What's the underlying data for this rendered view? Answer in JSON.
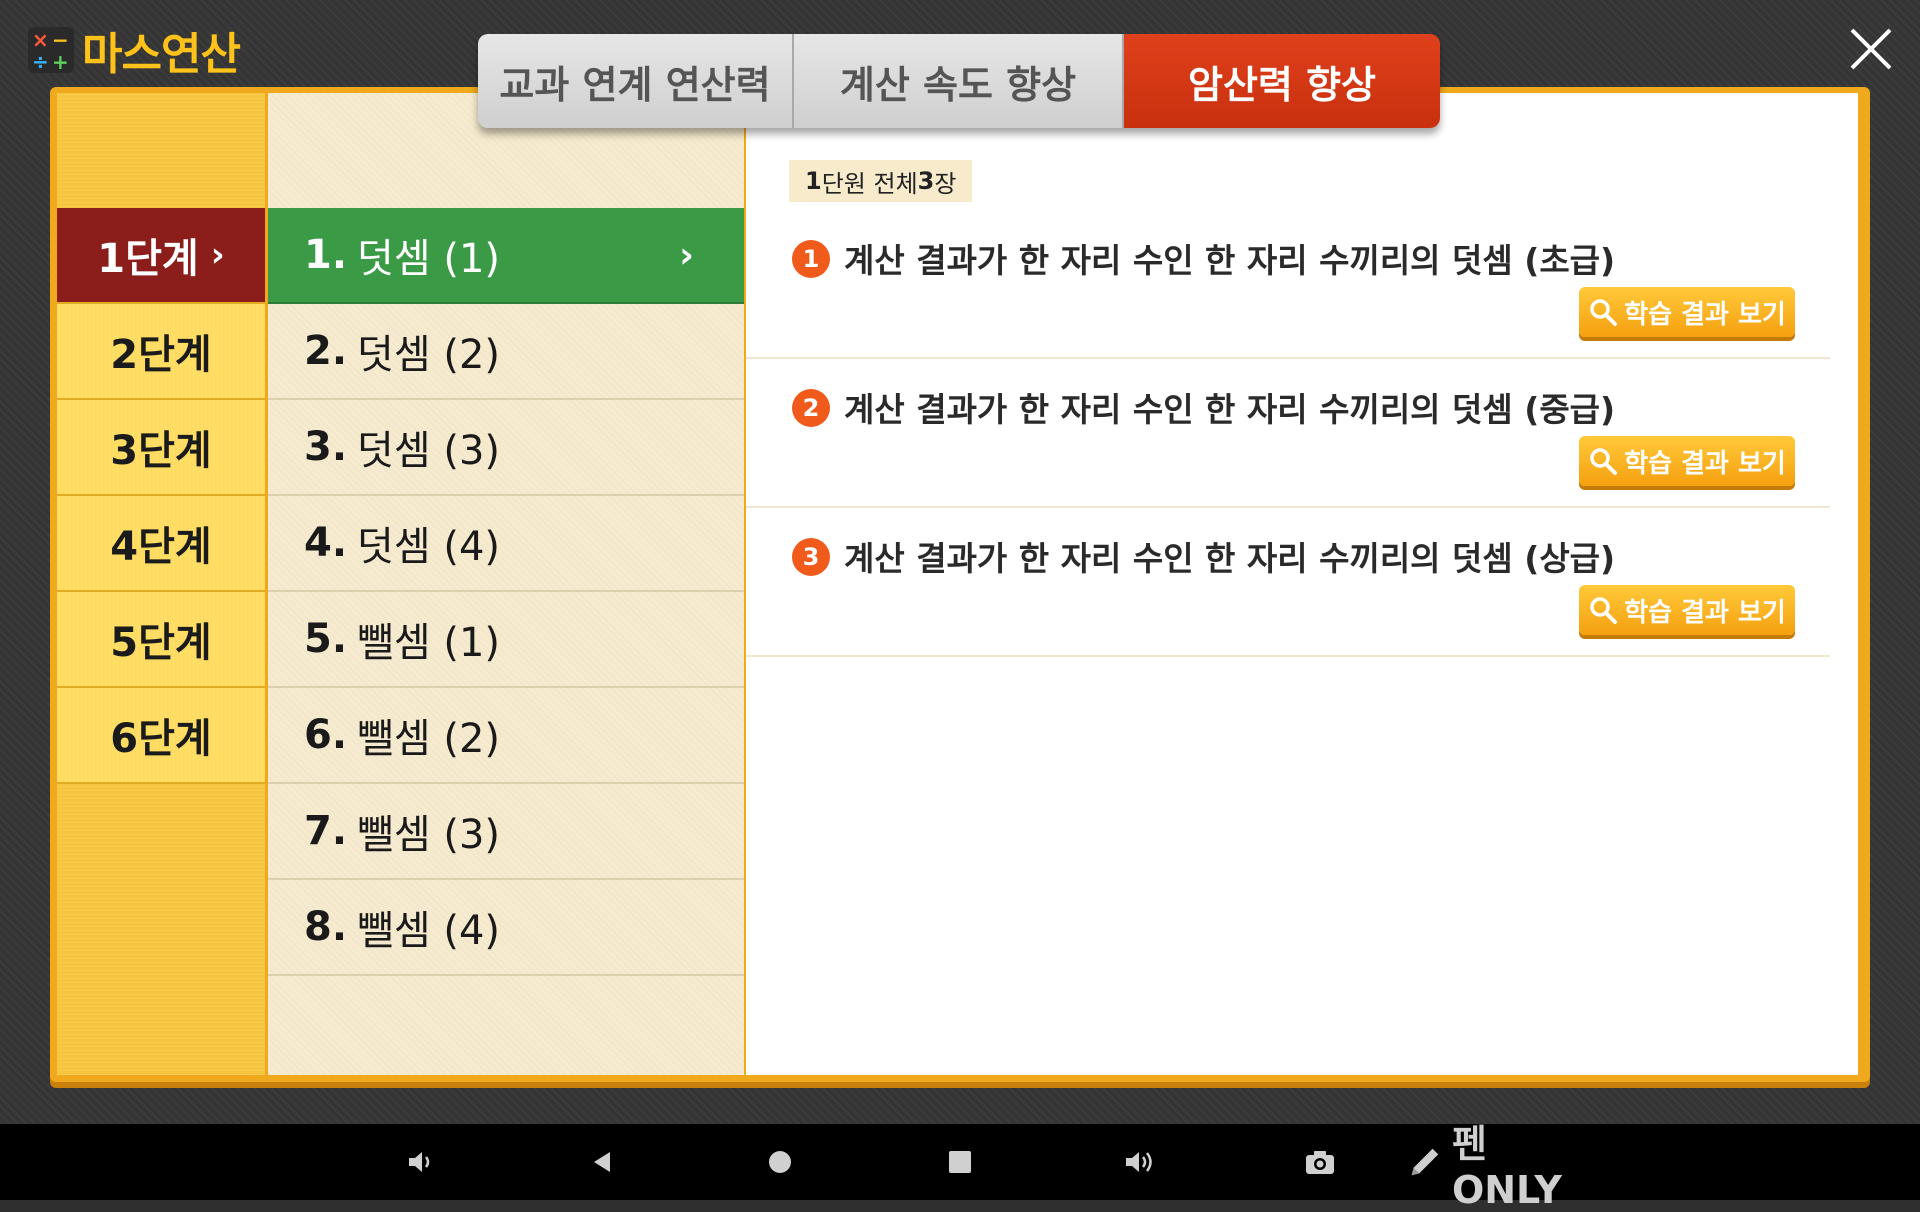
{
  "app": {
    "title": "마스연산"
  },
  "tabs": [
    {
      "label": "교과 연계 연산력",
      "active": false
    },
    {
      "label": "계산 속도 향상",
      "active": false
    },
    {
      "label": "암산력 향상",
      "active": true
    }
  ],
  "stages": [
    {
      "label": "1단계",
      "active": true
    },
    {
      "label": "2단계",
      "active": false
    },
    {
      "label": "3단계",
      "active": false
    },
    {
      "label": "4단계",
      "active": false
    },
    {
      "label": "5단계",
      "active": false
    },
    {
      "label": "6단계",
      "active": false
    }
  ],
  "units": [
    {
      "num": "1.",
      "label": "덧셈 (1)",
      "active": true
    },
    {
      "num": "2.",
      "label": "덧셈 (2)",
      "active": false
    },
    {
      "num": "3.",
      "label": "덧셈 (3)",
      "active": false
    },
    {
      "num": "4.",
      "label": "덧셈 (4)",
      "active": false
    },
    {
      "num": "5.",
      "label": "뺄셈 (1)",
      "active": false
    },
    {
      "num": "6.",
      "label": "뺄셈 (2)",
      "active": false
    },
    {
      "num": "7.",
      "label": "뺄셈 (3)",
      "active": false
    },
    {
      "num": "8.",
      "label": "뺄셈 (4)",
      "active": false
    }
  ],
  "summary": {
    "unit": "1",
    "unit_suffix": "단원 전체 ",
    "count": "3",
    "count_suffix": "장"
  },
  "lessons": [
    {
      "badge": "1",
      "title": "계산 결과가 한 자리 수인 한 자리 수끼리의 덧셈 (초급)",
      "button": "학습 결과 보기"
    },
    {
      "badge": "2",
      "title": "계산 결과가 한 자리 수인 한 자리 수끼리의 덧셈 (중급)",
      "button": "학습 결과 보기"
    },
    {
      "badge": "3",
      "title": "계산 결과가 한 자리 수인 한 자리 수끼리의 덧셈 (상급)",
      "button": "학습 결과 보기"
    }
  ],
  "navbar": {
    "pen_label": "펜 ONLY"
  },
  "icons": {
    "close": "close-icon",
    "chevron": "chevron-right-icon",
    "search": "search-icon",
    "volume_down": "volume-down-icon",
    "back": "back-icon",
    "home": "home-icon",
    "recents": "recents-icon",
    "volume_up": "volume-up-icon",
    "camera": "camera-icon",
    "pen": "pen-icon"
  },
  "colors": {
    "accent": "#ffc21a",
    "active_tab": "#d63a16",
    "active_stage": "#8b1e1a",
    "active_unit": "#3a9a46",
    "badge": "#f05a1a"
  }
}
